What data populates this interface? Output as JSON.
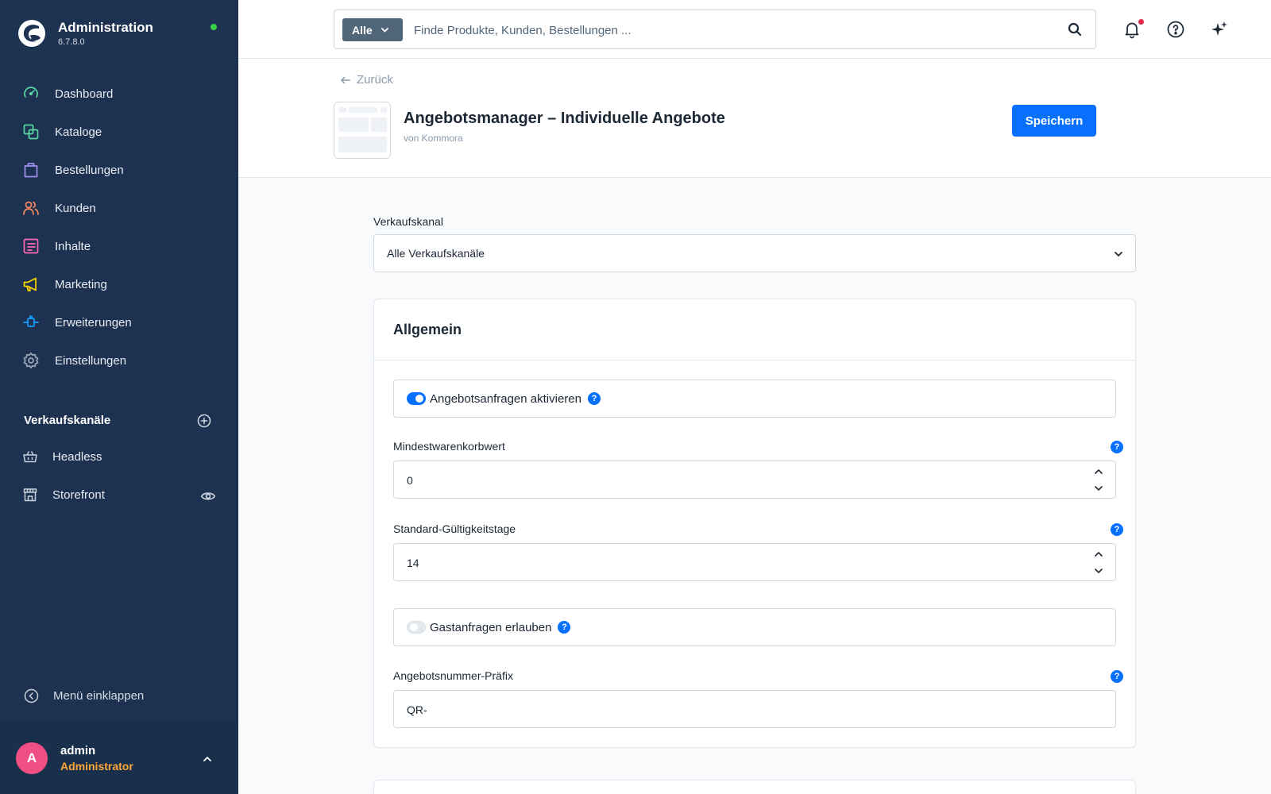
{
  "app": {
    "title": "Administration",
    "version": "6.7.8.0"
  },
  "sidebar": {
    "items": [
      {
        "label": "Dashboard",
        "icon": "dashboard-icon",
        "color": "#57d9a3"
      },
      {
        "label": "Kataloge",
        "icon": "catalog-icon",
        "color": "#57d9a3"
      },
      {
        "label": "Bestellungen",
        "icon": "shopping-bag-icon",
        "color": "#a092f0"
      },
      {
        "label": "Kunden",
        "icon": "customers-icon",
        "color": "#f88962"
      },
      {
        "label": "Inhalte",
        "icon": "content-icon",
        "color": "#ff68b4"
      },
      {
        "label": "Marketing",
        "icon": "megaphone-icon",
        "color": "#ffd700"
      },
      {
        "label": "Erweiterungen",
        "icon": "plug-icon",
        "color": "#189eff"
      },
      {
        "label": "Einstellungen",
        "icon": "gear-icon",
        "color": "#9aa8b5"
      }
    ],
    "sales_channels": {
      "heading": "Verkaufskanäle",
      "items": [
        {
          "label": "Headless",
          "icon": "basket-icon"
        },
        {
          "label": "Storefront",
          "icon": "storefront-icon"
        }
      ]
    },
    "collapse_label": "Menü einklappen",
    "user": {
      "initial": "A",
      "name": "admin",
      "role": "Administrator"
    }
  },
  "topbar": {
    "search_type": "Alle",
    "search_placeholder": "Finde Produkte, Kunden, Bestellungen ..."
  },
  "header": {
    "back_label": "Zurück",
    "title": "Angebotsmanager – Individuelle Angebote",
    "author": "von Kommora",
    "save_label": "Speichern"
  },
  "main": {
    "sales_channel_label": "Verkaufskanal",
    "sales_channel_value": "Alle Verkaufskanäle",
    "card_title": "Allgemein",
    "enable_requests": {
      "label": "Angebotsanfragen aktivieren",
      "checked": true
    },
    "min_cart": {
      "label": "Mindestwarenkorbwert",
      "value": "0"
    },
    "validity": {
      "label": "Standard-Gültigkeitstage",
      "value": "14"
    },
    "guest_requests": {
      "label": "Gastanfragen erlauben",
      "checked": false
    },
    "prefix": {
      "label": "Angebotsnummer-Präfix",
      "value": "QR-"
    },
    "help_glyph": "?"
  },
  "colors": {
    "sidebar_bg": "#1d3250",
    "primary": "#0870ff",
    "status_online": "#37d046",
    "avatar": "#f04f84",
    "role": "#ffa636"
  }
}
